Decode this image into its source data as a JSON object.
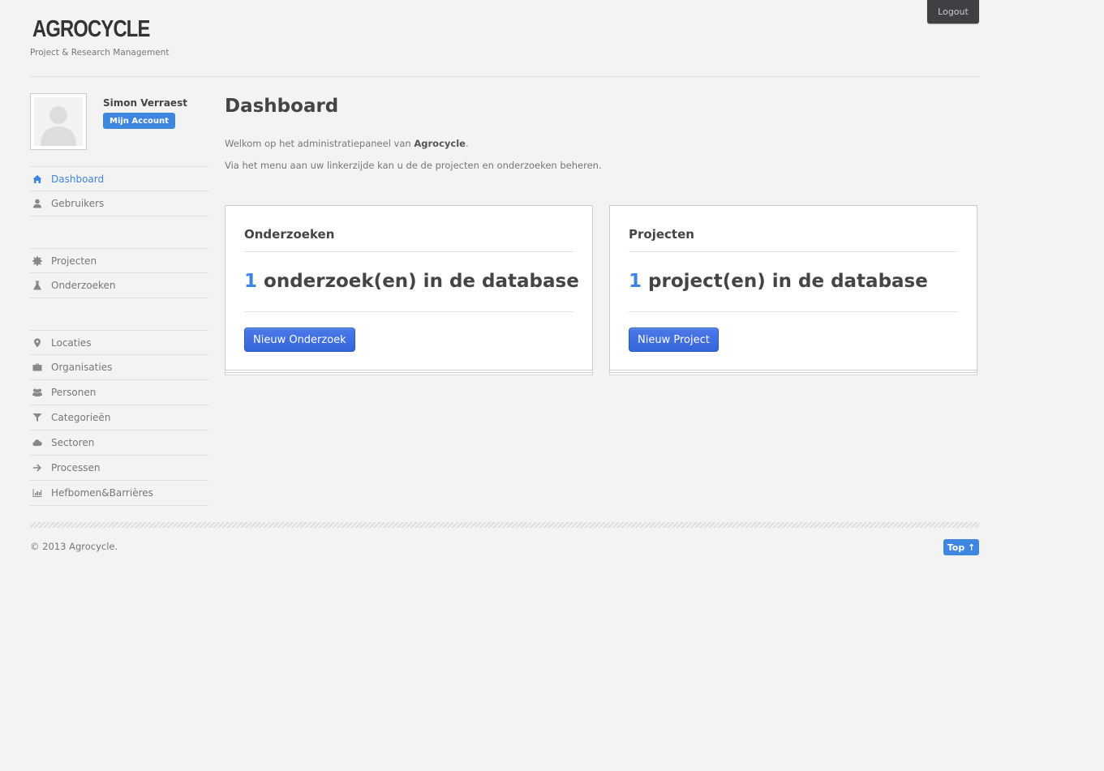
{
  "header": {
    "logo": "AGROCYCLE",
    "tagline": "Project & Research Management",
    "logout_label": "Logout"
  },
  "profile": {
    "name": "Simon Verraest",
    "account_label": "Mijn Account"
  },
  "sidebar": {
    "group1": [
      {
        "label": "Dashboard",
        "icon": "home-icon",
        "active": true
      },
      {
        "label": "Gebruikers",
        "icon": "user-icon"
      }
    ],
    "group2": [
      {
        "label": "Projecten",
        "icon": "cog-icon"
      },
      {
        "label": "Onderzoeken",
        "icon": "flask-icon"
      }
    ],
    "group3": [
      {
        "label": "Locaties",
        "icon": "map-marker-icon"
      },
      {
        "label": "Organisaties",
        "icon": "briefcase-icon"
      },
      {
        "label": "Personen",
        "icon": "group-icon"
      },
      {
        "label": "Categorieën",
        "icon": "filter-icon"
      },
      {
        "label": "Sectoren",
        "icon": "cloud-icon"
      },
      {
        "label": "Processen",
        "icon": "arrow-right-icon"
      },
      {
        "label": "Hefbomen&Barrières",
        "icon": "bar-chart-icon"
      }
    ]
  },
  "main": {
    "title": "Dashboard",
    "intro_prefix": "Welkom op het administratiepaneel van ",
    "intro_brand": "Agrocycle",
    "intro_suffix": ".",
    "intro2": "Via het menu aan uw linkerzijde kan u de de projecten en onderzoeken beheren.",
    "cards": [
      {
        "title": "Onderzoeken",
        "count": "1",
        "count_text": "onderzoek(en) in de database",
        "button": "Nieuw Onderzoek"
      },
      {
        "title": "Projecten",
        "count": "1",
        "count_text": "project(en) in de database",
        "button": "Nieuw Project"
      }
    ]
  },
  "footer": {
    "copyright": "© 2013 Agrocycle.",
    "top_label": "Top ↑"
  },
  "colors": {
    "accent": "#3e86e0",
    "button": "#3665d9",
    "background": "#f3f3f3"
  }
}
